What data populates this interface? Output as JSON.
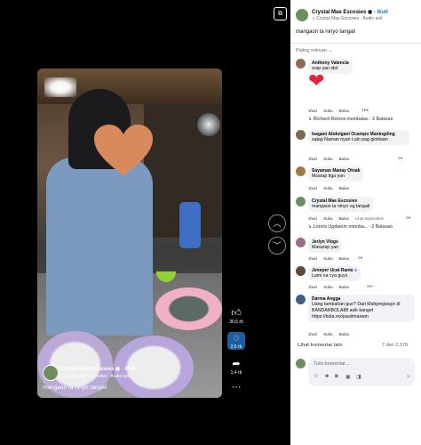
{
  "reel": {
    "author_name": "Crystal Mae Escosies",
    "follow_label": "Ikuti",
    "audio": "Crystal Mae Escosies · Audio asli",
    "caption": "mangaon ta ninyo tangali",
    "likes": "30,5 rb",
    "comments": "2,6 rb",
    "shares": "1,4 rb",
    "more": "···"
  },
  "panel": {
    "author_name": "Crystal Mae Escosies",
    "follow_label": "Ikuti",
    "audio": "Crystal Mae Escosies · Audio asli",
    "caption": "mangaon ta ninyo tangali",
    "sort_label": "Paling relevan"
  },
  "comments": [
    {
      "name": "Anthony Valencia",
      "text": "srap yan idol",
      "time": "1hari",
      "like": "Suka",
      "reply": "Balas",
      "reactions": "4",
      "replies": "Richard Relova membalas · 2 Balasan",
      "has_sticker": true
    },
    {
      "name": "Isagani Abdulgani Ocampo Maningding",
      "text": "satap Naman nyan Lalo pag giniitaan",
      "time": "1hari",
      "like": "Suka",
      "reply": "Balas",
      "reactions": "2"
    },
    {
      "name": "Sayaman Manay Otnak",
      "text": "Msarap tiga yan",
      "time": "1hari",
      "like": "Suka",
      "reply": "Balas",
      "reactions": ""
    },
    {
      "name": "Crystal Mae Escosies",
      "text": "mangaon ta ninyo og tangali",
      "time": "1hari",
      "like": "Suka",
      "reply": "Balas",
      "translate": "Lihat terjemahan",
      "reactions": "3",
      "replies": "Loreto Ugdamin memba... · 2 Balasan"
    },
    {
      "name": "Jerlyn Vlogs",
      "text": "Masarap yan",
      "time": "1hari",
      "like": "Suka",
      "reply": "Balas",
      "reactions": "2"
    },
    {
      "name": "Jeneper Ucat Rante",
      "text": "Lami na cya guys",
      "time": "1hari",
      "like": "Suka",
      "reply": "Balas",
      "reactions": "2"
    },
    {
      "name": "Darma Angga",
      "text": "Uang tambahan gue? Dari Mahjongways di BANDARBOLA88 asik banget https://bola.mx/pastimaxwin",
      "time": "1hari",
      "like": "Suka",
      "reply": "Balas",
      "reactions": ""
    }
  ],
  "footer": {
    "more_comments": "Lihat komentar lain",
    "pager": "7 dari 2.578",
    "placeholder": "Tulis komentar..."
  },
  "colors": {
    "accent": "#1877f2",
    "bubble": "#f0f2f5",
    "heart": "#e0243a"
  }
}
